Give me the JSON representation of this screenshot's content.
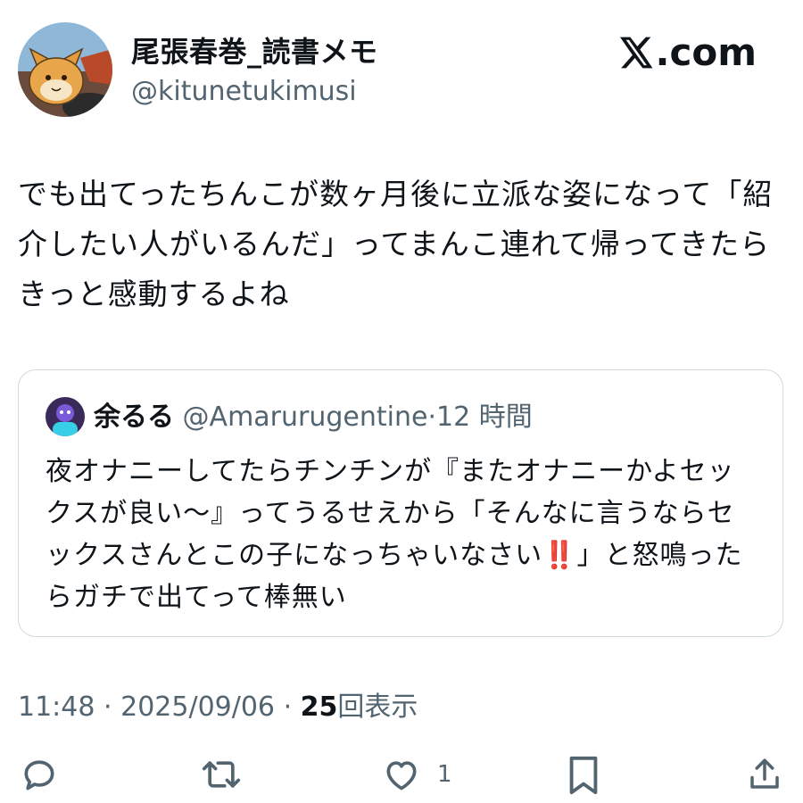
{
  "author": {
    "display_name": "尾張春巻_読書メモ",
    "handle": "@kitunetukimusi",
    "avatar_icon": "fox-avatar-icon"
  },
  "site": {
    "logo_label": ".com",
    "logo_icon": "x-logo-icon"
  },
  "tweet": {
    "text": "でも出てったちんこが数ヶ月後に立派な姿になって「紹介したい人がいるんだ」ってまんこ連れて帰ってきたらきっと感動するよね"
  },
  "quote": {
    "display_name": "余るる",
    "handle": "@Amarurugentine",
    "separator": "·",
    "time": "12 時間",
    "text_before": "夜オナニーしてたらチンチンが『またオナニーかよセックスが良い〜』ってうるせえから「そんなに言うならセックスさんとこの子になっちゃいなさい",
    "emphasis": "‼️",
    "text_after": "」と怒鳴ったらガチで出てって棒無い"
  },
  "meta": {
    "time": "11:48",
    "sep1": "·",
    "date": "2025/09/06",
    "sep2": "·",
    "views_count": "25",
    "views_label": "回表示"
  },
  "actions": {
    "like_count": "1",
    "icons": [
      "reply-icon",
      "retweet-icon",
      "like-icon",
      "bookmark-icon",
      "share-icon"
    ]
  },
  "colors": {
    "text": "#0f1419",
    "secondary": "#536471",
    "border": "#cfd9de",
    "emphasis": "#e0245e"
  }
}
